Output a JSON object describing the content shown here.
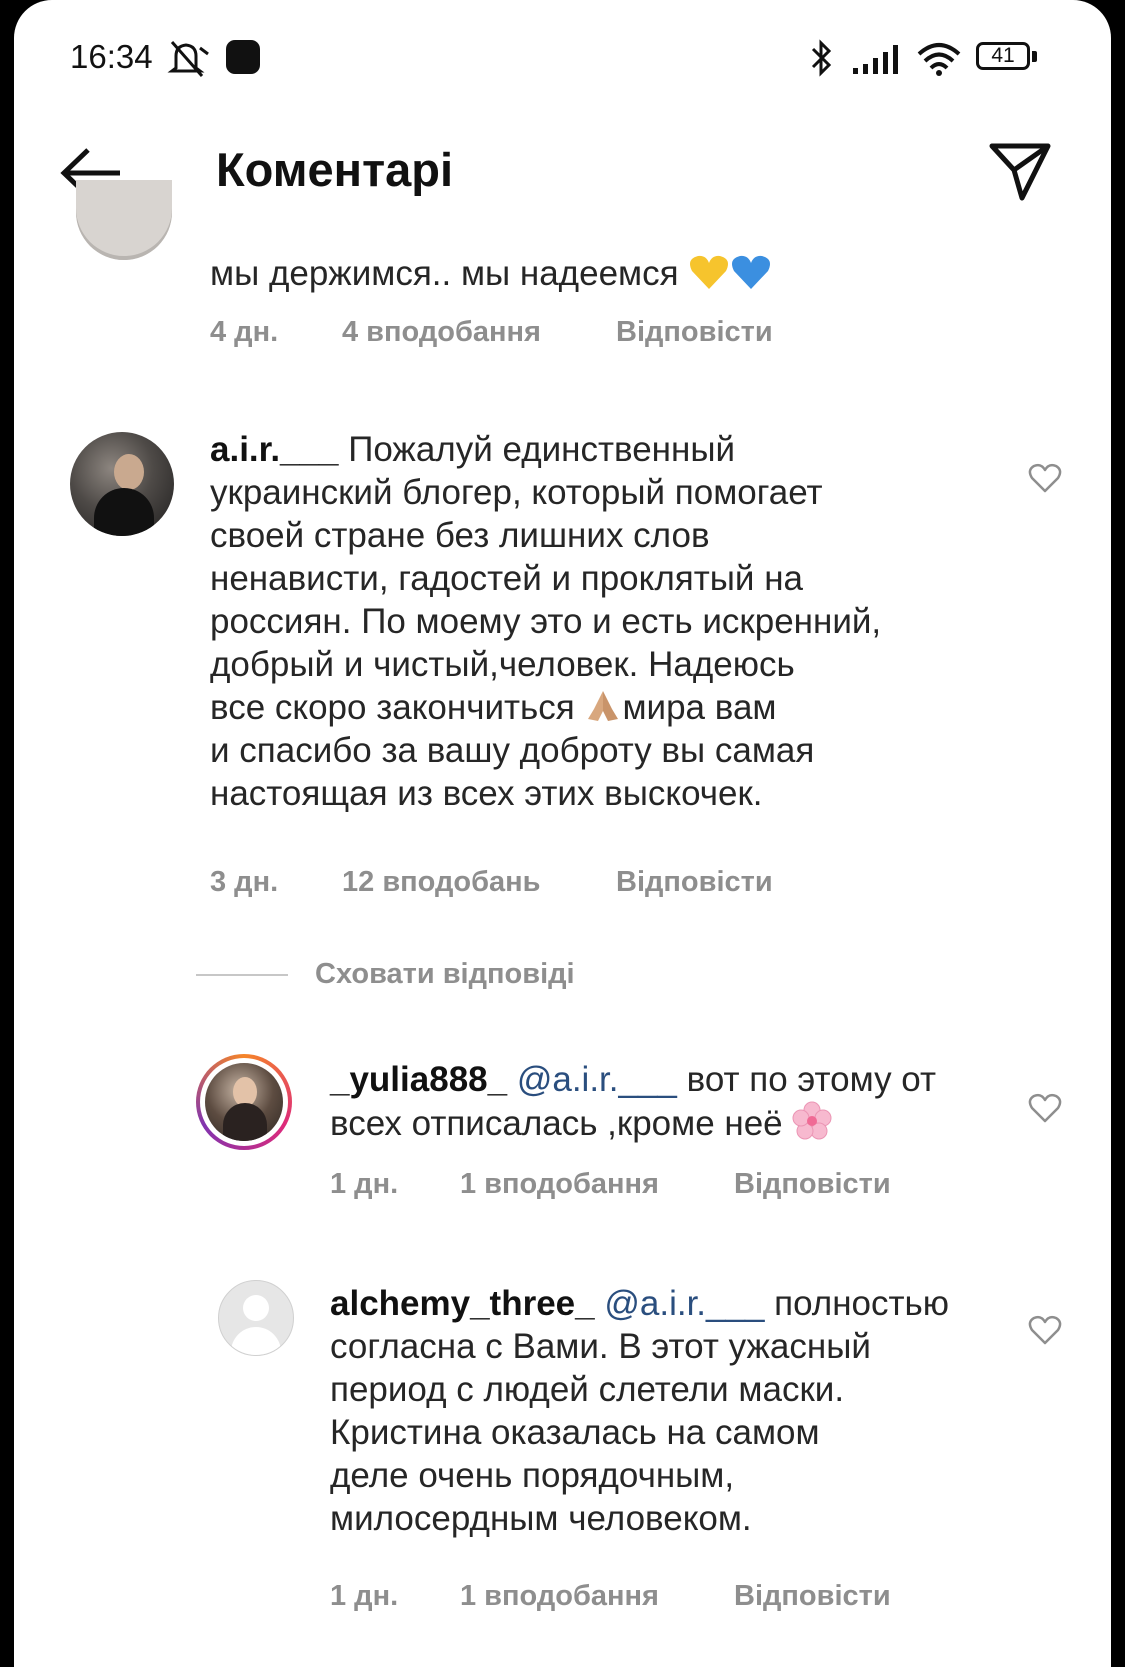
{
  "status_bar": {
    "time": "16:34",
    "battery": "41",
    "icons": [
      "mute-icon",
      "app-icon",
      "bluetooth-icon",
      "signal-icon",
      "wifi-icon",
      "battery-icon"
    ]
  },
  "header": {
    "title": "Коментарі",
    "back_icon": "arrow-left-icon",
    "share_icon": "send-icon"
  },
  "comments": [
    {
      "username": "",
      "text": "мы держимся.. мы надеемся",
      "emoji": [
        "yellow-heart",
        "blue-heart"
      ],
      "time": "4 дн.",
      "likes": "4 вподобання",
      "reply": "Відповісти"
    },
    {
      "username": "a.i.r.___",
      "lines": [
        "Пожалуй единственный",
        "украинский блогер, который помогает",
        "своей стране без лишних слов",
        "ненависти, гадостей и проклятый на",
        "россиян. По моему это и есть искренний,",
        "добрый и чистый,человек. Надеюсь",
        "все скоро закончиться",
        "мира вам",
        "и спасибо за вашу доброту вы самая",
        "настоящая из всех этих выскочек."
      ],
      "emoji": [
        "praying-hands"
      ],
      "time": "3 дн.",
      "likes": "12 вподобань",
      "reply": "Відповісти",
      "hide_replies": "Сховати відповіді"
    }
  ],
  "replies": [
    {
      "username": "_yulia888_",
      "mention": "@a.i.r.___",
      "lines": [
        "вот по этому от",
        "всех отписалась ,кроме неё"
      ],
      "emoji": [
        "cherry-blossom"
      ],
      "time": "1 дн.",
      "likes": "1 вподобання",
      "reply": "Відповісти"
    },
    {
      "username": "alchemy_three_",
      "mention": "@a.i.r.___",
      "lines": [
        "полностью",
        "согласна с Вами. В этот ужасный",
        "период с людей слетели маски.",
        "Кристина оказалась на самом",
        "деле очень порядочным,",
        "милосердным человеком."
      ],
      "time": "1 дн.",
      "likes": "1 вподобання",
      "reply": "Відповісти"
    }
  ]
}
